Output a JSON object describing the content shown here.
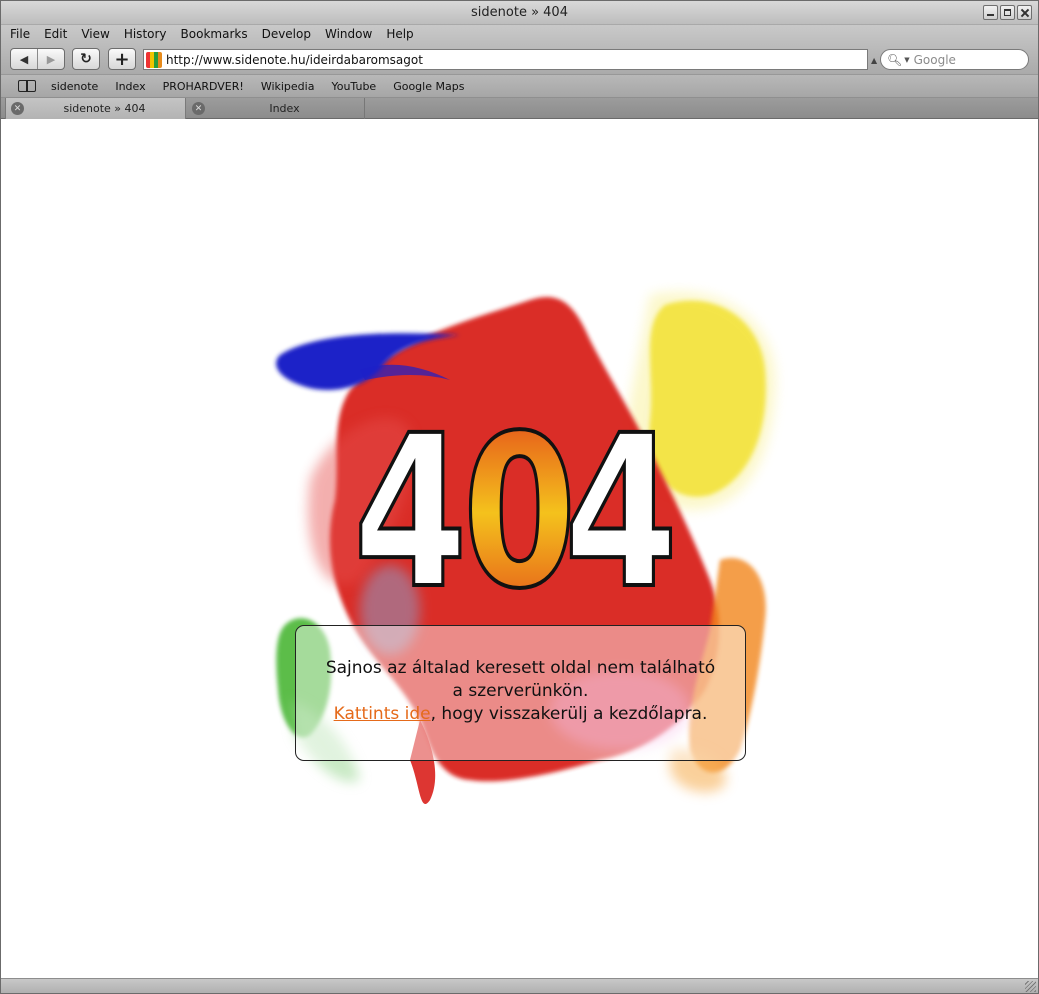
{
  "window": {
    "title": "sidenote » 404"
  },
  "menubar": [
    "File",
    "Edit",
    "View",
    "History",
    "Bookmarks",
    "Develop",
    "Window",
    "Help"
  ],
  "toolbar": {
    "back_icon": "back-arrow-icon",
    "forward_icon": "forward-arrow-icon",
    "reload_icon": "reload-icon",
    "add_icon": "plus-icon",
    "url": "http://www.sidenote.hu/ideirdabaromsagot",
    "search_placeholder": "Google"
  },
  "bookmarks": [
    "sidenote",
    "Index",
    "PROHARDVER!",
    "Wikipedia",
    "YouTube",
    "Google Maps"
  ],
  "tabs": [
    {
      "label": "sidenote » 404",
      "active": true
    },
    {
      "label": "Index",
      "active": false
    }
  ],
  "page": {
    "error_code": "404",
    "message_line1": "Sajnos az általad keresett oldal nem található",
    "message_line2": "a szerverünkön.",
    "link_text": "Kattints ide",
    "message_line3_rest": ", hogy visszakerülj a kezdőlapra.",
    "colors": {
      "red": "#d9201c",
      "yellow": "#f1df22",
      "blue": "#1c20c8",
      "green": "#3fb22c",
      "orange": "#f2861f",
      "link": "#e56a1a"
    }
  }
}
